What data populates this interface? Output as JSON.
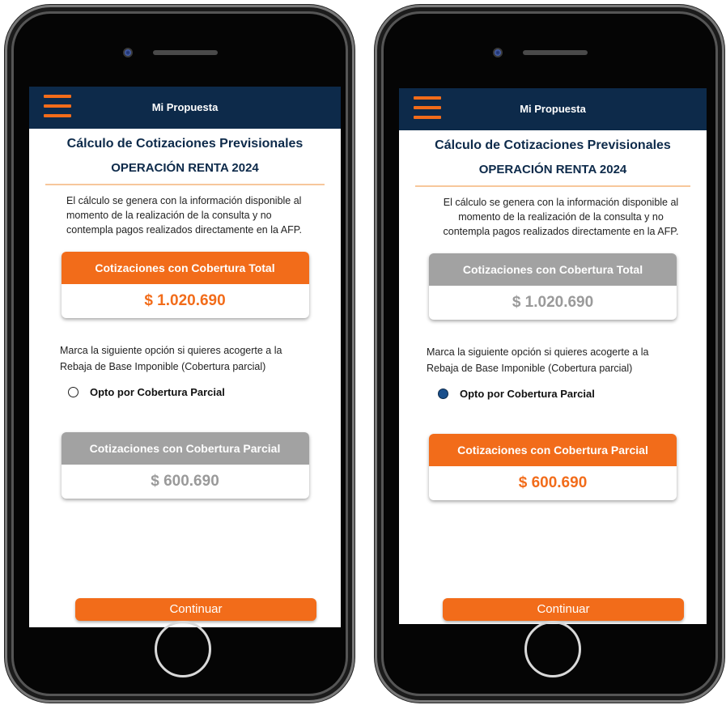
{
  "colors": {
    "navy": "#0d2a4a",
    "orange": "#f26c1a",
    "gray": "#a2a2a2"
  },
  "phones": [
    {
      "appbar_title": "Mi Propuesta",
      "title": "Cálculo de Cotizaciones Previsionales",
      "subtitle": "OPERACIÓN RENTA 2024",
      "info": "El cálculo se genera con la información disponible al momento de la realización de la consulta y no contempla pagos realizados directamente en la AFP.",
      "total_card": {
        "label": "Cotizaciones con Cobertura Total",
        "value": "$ 1.020.690"
      },
      "option_text": "Marca la siguiente opción si quieres acogerte a la Rebaja de Base Imponible (Cobertura parcial)",
      "radio_label": "Opto por Cobertura Parcial",
      "radio_checked": false,
      "partial_card": {
        "label": "Cotizaciones con Cobertura Parcial",
        "value": "$ 600.690"
      },
      "continue_label": "Continuar"
    },
    {
      "appbar_title": "Mi Propuesta",
      "title": "Cálculo de Cotizaciones Previsionales",
      "subtitle": "OPERACIÓN RENTA 2024",
      "info": "El cálculo se genera con la información disponible al momento de la realización de la consulta y no contempla pagos realizados directamente en la AFP.",
      "total_card": {
        "label": "Cotizaciones con Cobertura Total",
        "value": "$ 1.020.690"
      },
      "option_text": "Marca la siguiente opción si quieres acogerte a la Rebaja de Base Imponible (Cobertura parcial)",
      "radio_label": "Opto por Cobertura Parcial",
      "radio_checked": true,
      "partial_card": {
        "label": "Cotizaciones con Cobertura Parcial",
        "value": "$ 600.690"
      },
      "continue_label": "Continuar"
    }
  ]
}
